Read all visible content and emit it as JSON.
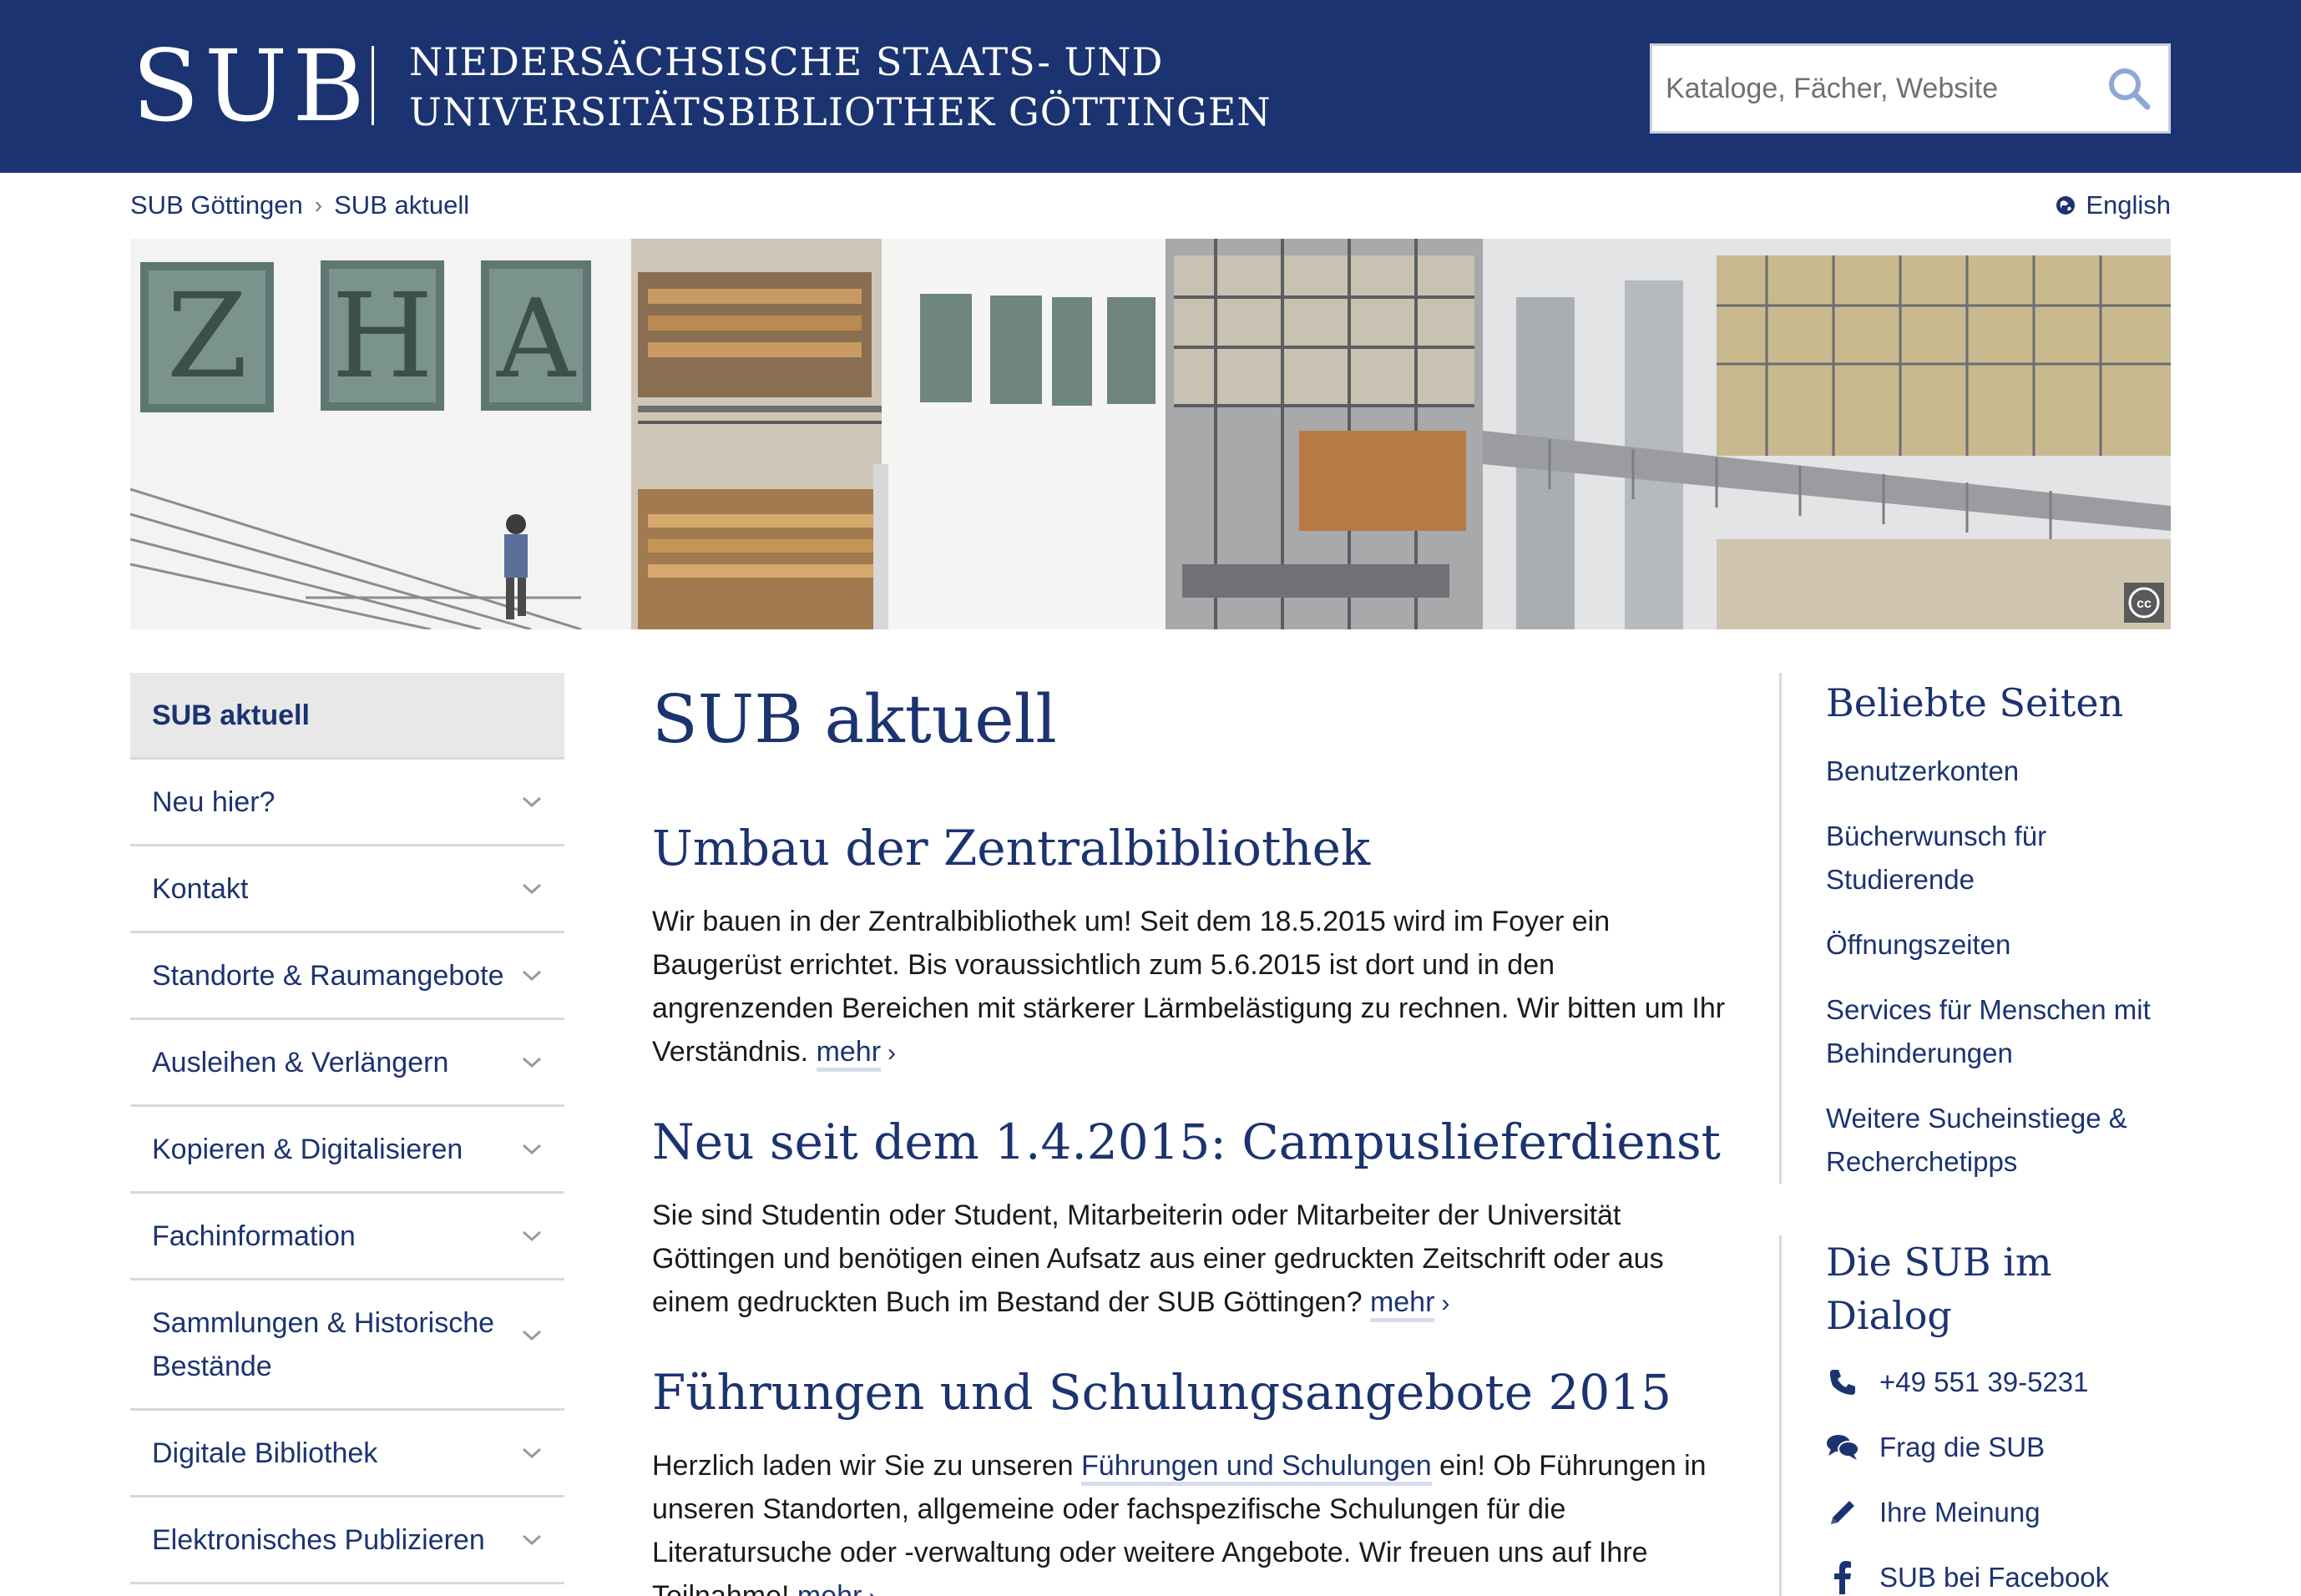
{
  "header": {
    "logo_mark": "SUB",
    "logo_line1": "NIEDERSÄCHSISCHE STAATS- UND",
    "logo_line2": "UNIVERSITÄTSBIBLIOTHEK GÖTTINGEN",
    "search_placeholder": "Kataloge, Fächer, Website",
    "brand_color": "#1b3370"
  },
  "breadcrumb": {
    "items": [
      "SUB Göttingen",
      "SUB aktuell"
    ],
    "separator": "›"
  },
  "language": {
    "label": "English",
    "icon": "globe-icon"
  },
  "hero": {
    "license_badge": "cc"
  },
  "leftnav": {
    "items": [
      {
        "label": "SUB aktuell",
        "active": true
      },
      {
        "label": "Neu hier?"
      },
      {
        "label": "Kontakt"
      },
      {
        "label": "Standorte & Raumangebote"
      },
      {
        "label": "Ausleihen & Verlängern"
      },
      {
        "label": "Kopieren & Digitalisieren"
      },
      {
        "label": "Fachinformation"
      },
      {
        "label": "Sammlungen & Historische Bestände"
      },
      {
        "label": "Digitale Bibliothek"
      },
      {
        "label": "Elektronisches Publizieren"
      }
    ]
  },
  "main": {
    "title": "SUB aktuell",
    "articles": [
      {
        "title": "Umbau der Zentralbibliothek",
        "text": "Wir bauen in der Zentralbibliothek um! Seit dem 18.5.2015 wird im Foyer ein Baugerüst errichtet. Bis voraussichtlich zum 5.6.2015 ist dort und in den angrenzenden Bereichen mit stärkerer Lärmbelästigung zu rechnen. Wir bitten um Ihr Verständnis.",
        "more": "mehr"
      },
      {
        "title": "Neu seit dem 1.4.2015: Campuslieferdienst",
        "text": "Sie sind Studentin oder Student, Mitarbeiterin oder Mitarbeiter der Universität Göttingen und benötigen einen Aufsatz aus einer gedruckten Zeitschrift oder aus einem gedruckten Buch im Bestand der SUB Göttingen?",
        "more": "mehr"
      },
      {
        "title": "Führungen und Schulungsangebote 2015",
        "text_before": "Herzlich laden wir Sie zu unseren",
        "link": "Führungen und Schulungen",
        "text_after": "ein! Ob Führungen in unseren Standorten, allgemeine oder fachspezifische Schulungen für die Literatursuche oder -verwaltung oder weitere Angebote. Wir freuen uns auf Ihre Teilnahme!",
        "more": "mehr"
      }
    ]
  },
  "sidebar": {
    "popular_heading": "Beliebte Seiten",
    "popular_links": [
      "Benutzerkonten",
      "Bücherwunsch für Studierende",
      "Öffnungszeiten",
      "Services für Menschen mit Behinderungen",
      "Weitere Sucheinstiege & Recherchetipps"
    ],
    "dialog_heading": "Die SUB im Dialog",
    "dialog_items": [
      {
        "label": "+49 551 39-5231",
        "icon": "phone-icon"
      },
      {
        "label": "Frag die SUB",
        "icon": "chat-icon"
      },
      {
        "label": "Ihre Meinung",
        "icon": "pencil-icon"
      },
      {
        "label": "SUB bei Facebook",
        "icon": "facebook-icon"
      }
    ]
  }
}
